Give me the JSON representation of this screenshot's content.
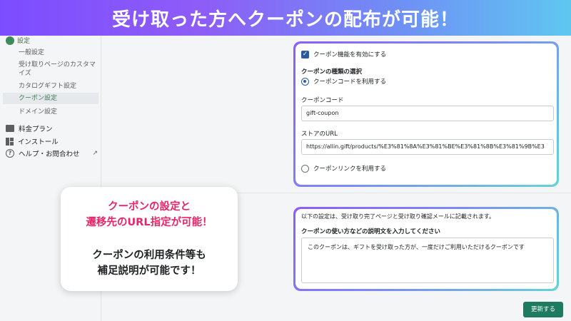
{
  "banner": {
    "text": "受け取った方へクーポンの配布が可能！"
  },
  "sidebar": {
    "header": "設定",
    "sub_items": [
      {
        "label": "一般設定"
      },
      {
        "label": "受け取りページのカスタマ"
      },
      {
        "label": "イズ"
      },
      {
        "label": "カタログギフト設定"
      },
      {
        "label": "クーポン設定"
      },
      {
        "label": "ドメイン設定"
      }
    ],
    "main_items": [
      {
        "label": "料金プラン",
        "icon": "billing-icon"
      },
      {
        "label": "インストール",
        "icon": "install-icon"
      },
      {
        "label": "ヘルプ・お問合わせ",
        "icon": "help-icon"
      }
    ]
  },
  "coupon_card": {
    "enable_label": "クーポン機能を有効にする",
    "type_heading": "クーポンの種類の選択",
    "option_code": "クーポンコードを利用する",
    "code_label": "クーポンコード",
    "code_value": "gift-coupon",
    "url_label": "ストアのURL",
    "url_value": "https://allin.gift/products/%E3%81%8A%E3%81%BE%E3%81%8B%E3%81%9B%E3",
    "option_link": "クーポンリンクを利用する"
  },
  "description_card": {
    "note": "以下の設定は、受け取り完了ページと受け取り確認メールに記載されます。",
    "field_label": "クーポンの使い方などの説明文を入力してください",
    "field_value": "このクーポンは、ギフトを受け取った方が、一度だけご利用いただけるクーポンです"
  },
  "save_button": "更新する",
  "callout": {
    "line1": "クーポンの設定と",
    "line2": "遷移先のURL指定が可能！",
    "line3": "クーポンの利用条件等も",
    "line4": "補足説明が可能です！"
  },
  "colors": {
    "accent_green": "#1e7b5f",
    "highlight_pink": "#e8246a",
    "checkbox_blue": "#2c5aa0"
  }
}
